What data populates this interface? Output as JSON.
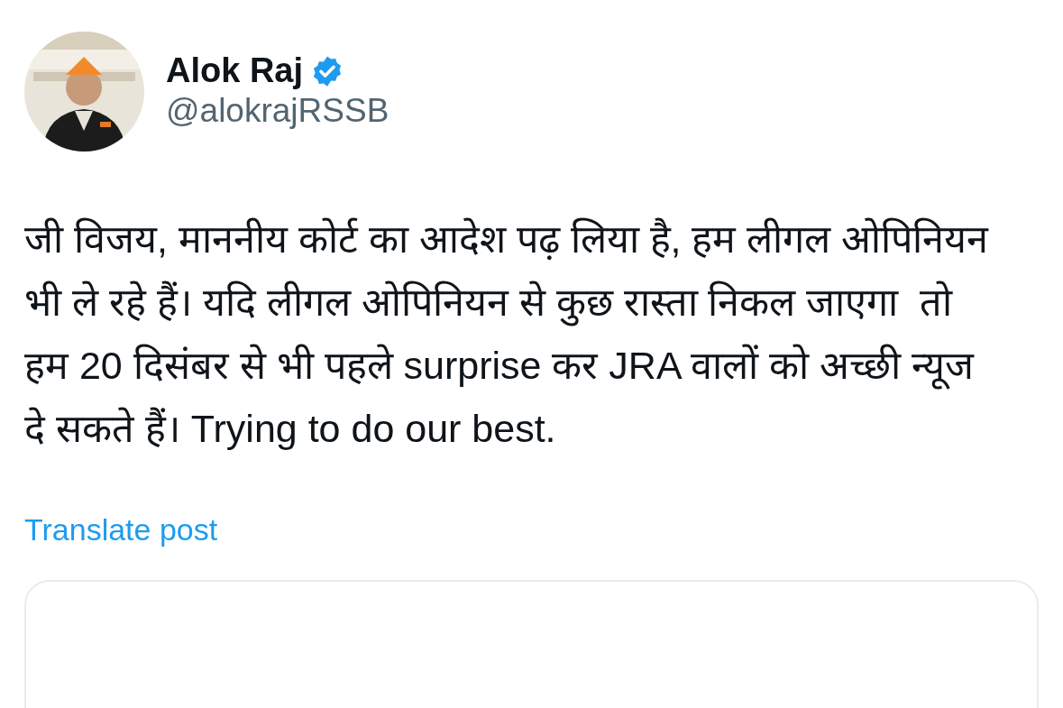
{
  "author": {
    "name": "Alok Raj",
    "verified": true,
    "handle": "@alokrajRSSB"
  },
  "post": {
    "text": "जी विजय, माननीय कोर्ट का आदेश पढ़ लिया है, हम लीगल ओपिनियन भी ले रहे हैं। यदि लीगल ओपिनियन से कुछ रास्ता निकल जाएगा  तो हम 20 दिसंबर से भी पहले surprise कर JRA वालों को अच्छी न्यूज दे सकते हैं। Trying to do our best."
  },
  "translate_link": "Translate post"
}
